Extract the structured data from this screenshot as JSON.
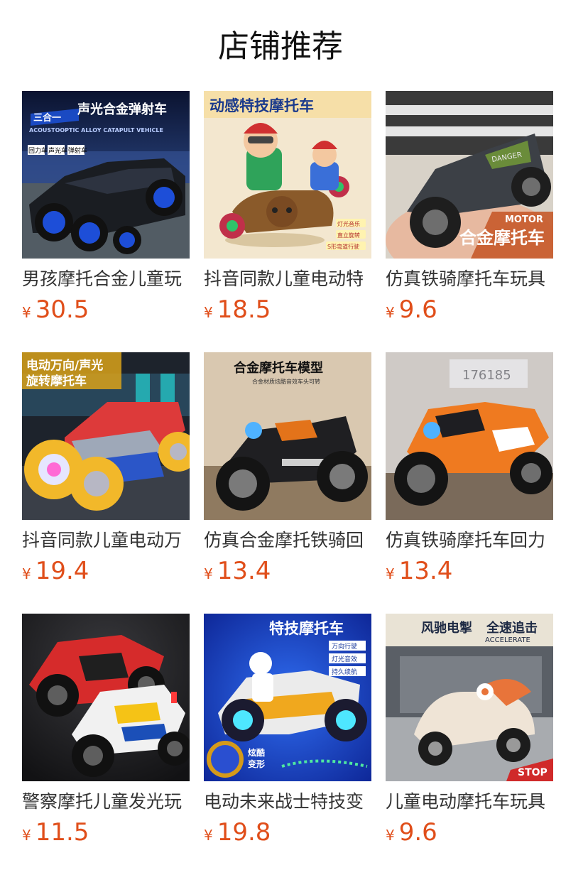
{
  "page": {
    "title": "店铺推荐"
  },
  "products": [
    {
      "title": "男孩摩托合金儿童玩",
      "currency": "¥",
      "price": "30.5",
      "image_text": [
        "三合一",
        "声光合金弹射车",
        "ACOUSTOOPTIC ALLOY CATAPULT VEHICLE",
        "回力车",
        "声光车",
        "弹射车"
      ]
    },
    {
      "title": "抖音同款儿童电动特",
      "currency": "¥",
      "price": "18.5",
      "image_text": [
        "动感特技摩托车",
        "灯光音乐",
        "直立旋转",
        "S形弯道行驶"
      ]
    },
    {
      "title": "仿真铁骑摩托车玩具",
      "currency": "¥",
      "price": "9.6",
      "image_text": [
        "MOTOR",
        "合金摩托车",
        "DANGER"
      ]
    },
    {
      "title": "抖音同款儿童电动万",
      "currency": "¥",
      "price": "19.4",
      "image_text": [
        "电动万向/声光",
        "旋转摩托车"
      ]
    },
    {
      "title": "仿真合金摩托铁骑回",
      "currency": "¥",
      "price": "13.4",
      "image_text": [
        "合金摩托车模型",
        "合金材质炫酷音效车头可转"
      ]
    },
    {
      "title": "仿真铁骑摩托车回力",
      "currency": "¥",
      "price": "13.4",
      "image_text": [
        "176185"
      ]
    },
    {
      "title": "警察摩托儿童发光玩",
      "currency": "¥",
      "price": "11.5",
      "image_text": []
    },
    {
      "title": "电动未来战士特技变",
      "currency": "¥",
      "price": "19.8",
      "image_text": [
        "特技摩托车",
        "万向行驶",
        "灯光音效",
        "持久续航",
        "炫酷",
        "变形"
      ]
    },
    {
      "title": "儿童电动摩托车玩具",
      "currency": "¥",
      "price": "9.6",
      "image_text": [
        "风驰电掣",
        "全速追击",
        "ACCELERATE",
        "STOP"
      ]
    }
  ],
  "colors": {
    "price": "#e04e1a",
    "title": "#111111",
    "text": "#333333"
  }
}
